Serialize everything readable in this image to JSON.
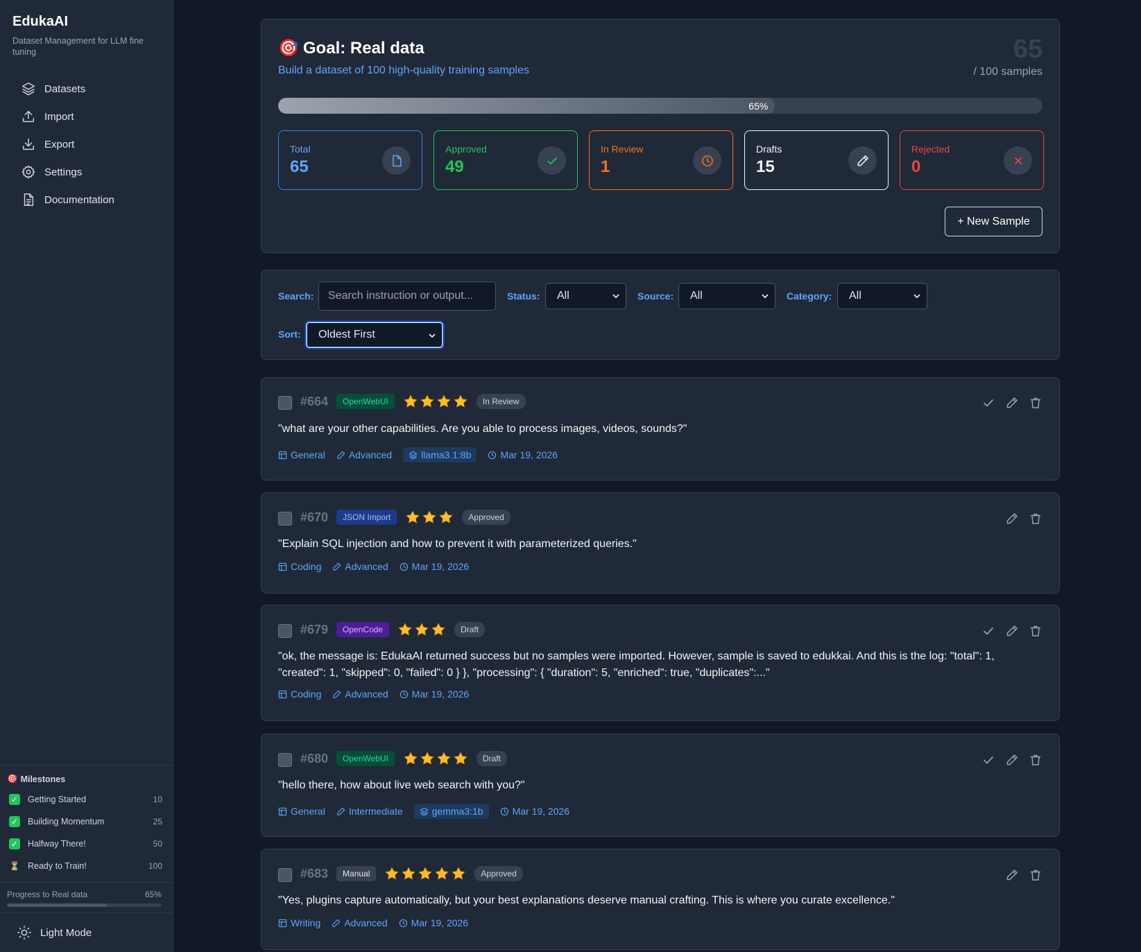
{
  "app": {
    "title": "EdukaAI",
    "subtitle": "Dataset Management for LLM fine tuning"
  },
  "nav": [
    {
      "label": "Datasets",
      "icon": "layers-icon"
    },
    {
      "label": "Import",
      "icon": "upload-icon"
    },
    {
      "label": "Export",
      "icon": "download-icon"
    },
    {
      "label": "Settings",
      "icon": "gear-icon"
    },
    {
      "label": "Documentation",
      "icon": "document-icon"
    }
  ],
  "milestones": {
    "title": "Milestones",
    "items": [
      {
        "label": "Getting Started",
        "target": "10",
        "done": true
      },
      {
        "label": "Building Momentum",
        "target": "25",
        "done": true
      },
      {
        "label": "Halfway There!",
        "target": "50",
        "done": true
      },
      {
        "label": "Ready to Train!",
        "target": "100",
        "done": false
      }
    ],
    "progress_label": "Progress to Real data",
    "progress_pct_text": "65%",
    "progress_value": 0.65
  },
  "theme_toggle": "Light Mode",
  "goal": {
    "icon": "🎯",
    "title": "Goal: Real data",
    "subtitle": "Build a dataset of 100 high-quality training samples",
    "count": "65",
    "total_text": "/ 100 samples",
    "progress_value": 0.65,
    "progress_text": "65%",
    "stats": [
      {
        "label": "Total",
        "value": "65",
        "color": "#60a5fa",
        "icon": "file-icon"
      },
      {
        "label": "Approved",
        "value": "49",
        "color": "#22c55e",
        "icon": "check-icon"
      },
      {
        "label": "In Review",
        "value": "1",
        "color": "#f97316",
        "icon": "clock-icon"
      },
      {
        "label": "Drafts",
        "value": "15",
        "color": "#f3f4f6",
        "icon": "pencil-icon"
      },
      {
        "label": "Rejected",
        "value": "0",
        "color": "#ef4444",
        "icon": "x-icon"
      }
    ],
    "new_button": "+ New Sample"
  },
  "filters": {
    "search_label": "Search:",
    "search_placeholder": "Search instruction or output...",
    "status_label": "Status:",
    "status_value": "All",
    "source_label": "Source:",
    "source_value": "All",
    "category_label": "Category:",
    "category_value": "All",
    "sort_label": "Sort:",
    "sort_value": "Oldest First"
  },
  "samples": [
    {
      "id": "#664",
      "source": "OpenWebUI",
      "source_color": "#34d399",
      "source_bg": "#064e3b",
      "stars": 4,
      "status": "In Review",
      "text": "\"what are your other capabilities. Are you able to process images, videos, sounds?\"",
      "category": "General",
      "level": "Advanced",
      "model": "llama3.1:8b",
      "date": "Mar 19, 2026",
      "approve": true
    },
    {
      "id": "#670",
      "source": "JSON Import",
      "source_color": "#93c5fd",
      "source_bg": "#1e3a8a",
      "stars": 3,
      "status": "Approved",
      "text": "\"Explain SQL injection and how to prevent it with parameterized queries.\"",
      "category": "Coding",
      "level": "Advanced",
      "model": "",
      "date": "Mar 19, 2026",
      "approve": false
    },
    {
      "id": "#679",
      "source": "OpenCode",
      "source_color": "#d8b4fe",
      "source_bg": "#4c1d95",
      "stars": 3,
      "status": "Draft",
      "text": "\"ok, the message is: EdukaAI returned success but no samples were imported. However, sample is saved to edukkai. And this is the log: \"total\": 1, \"created\": 1, \"skipped\": 0, \"failed\": 0 } }, \"processing\": { \"duration\": 5, \"enriched\": true, \"duplicates\":...\"",
      "category": "Coding",
      "level": "Advanced",
      "model": "",
      "date": "Mar 19, 2026",
      "approve": true
    },
    {
      "id": "#680",
      "source": "OpenWebUI",
      "source_color": "#34d399",
      "source_bg": "#064e3b",
      "stars": 4,
      "status": "Draft",
      "text": "\"hello there, how about live web search with you?\"",
      "category": "General",
      "level": "Intermediate",
      "model": "gemma3:1b",
      "date": "Mar 19, 2026",
      "approve": true
    },
    {
      "id": "#683",
      "source": "Manual",
      "source_color": "#e5e7eb",
      "source_bg": "#374151",
      "stars": 5,
      "status": "Approved",
      "text": "\"Yes, plugins capture automatically, but your best explanations deserve manual crafting. This is where you curate excellence.\"",
      "category": "Writing",
      "level": "Advanced",
      "model": "",
      "date": "Mar 19, 2026",
      "approve": false
    }
  ]
}
